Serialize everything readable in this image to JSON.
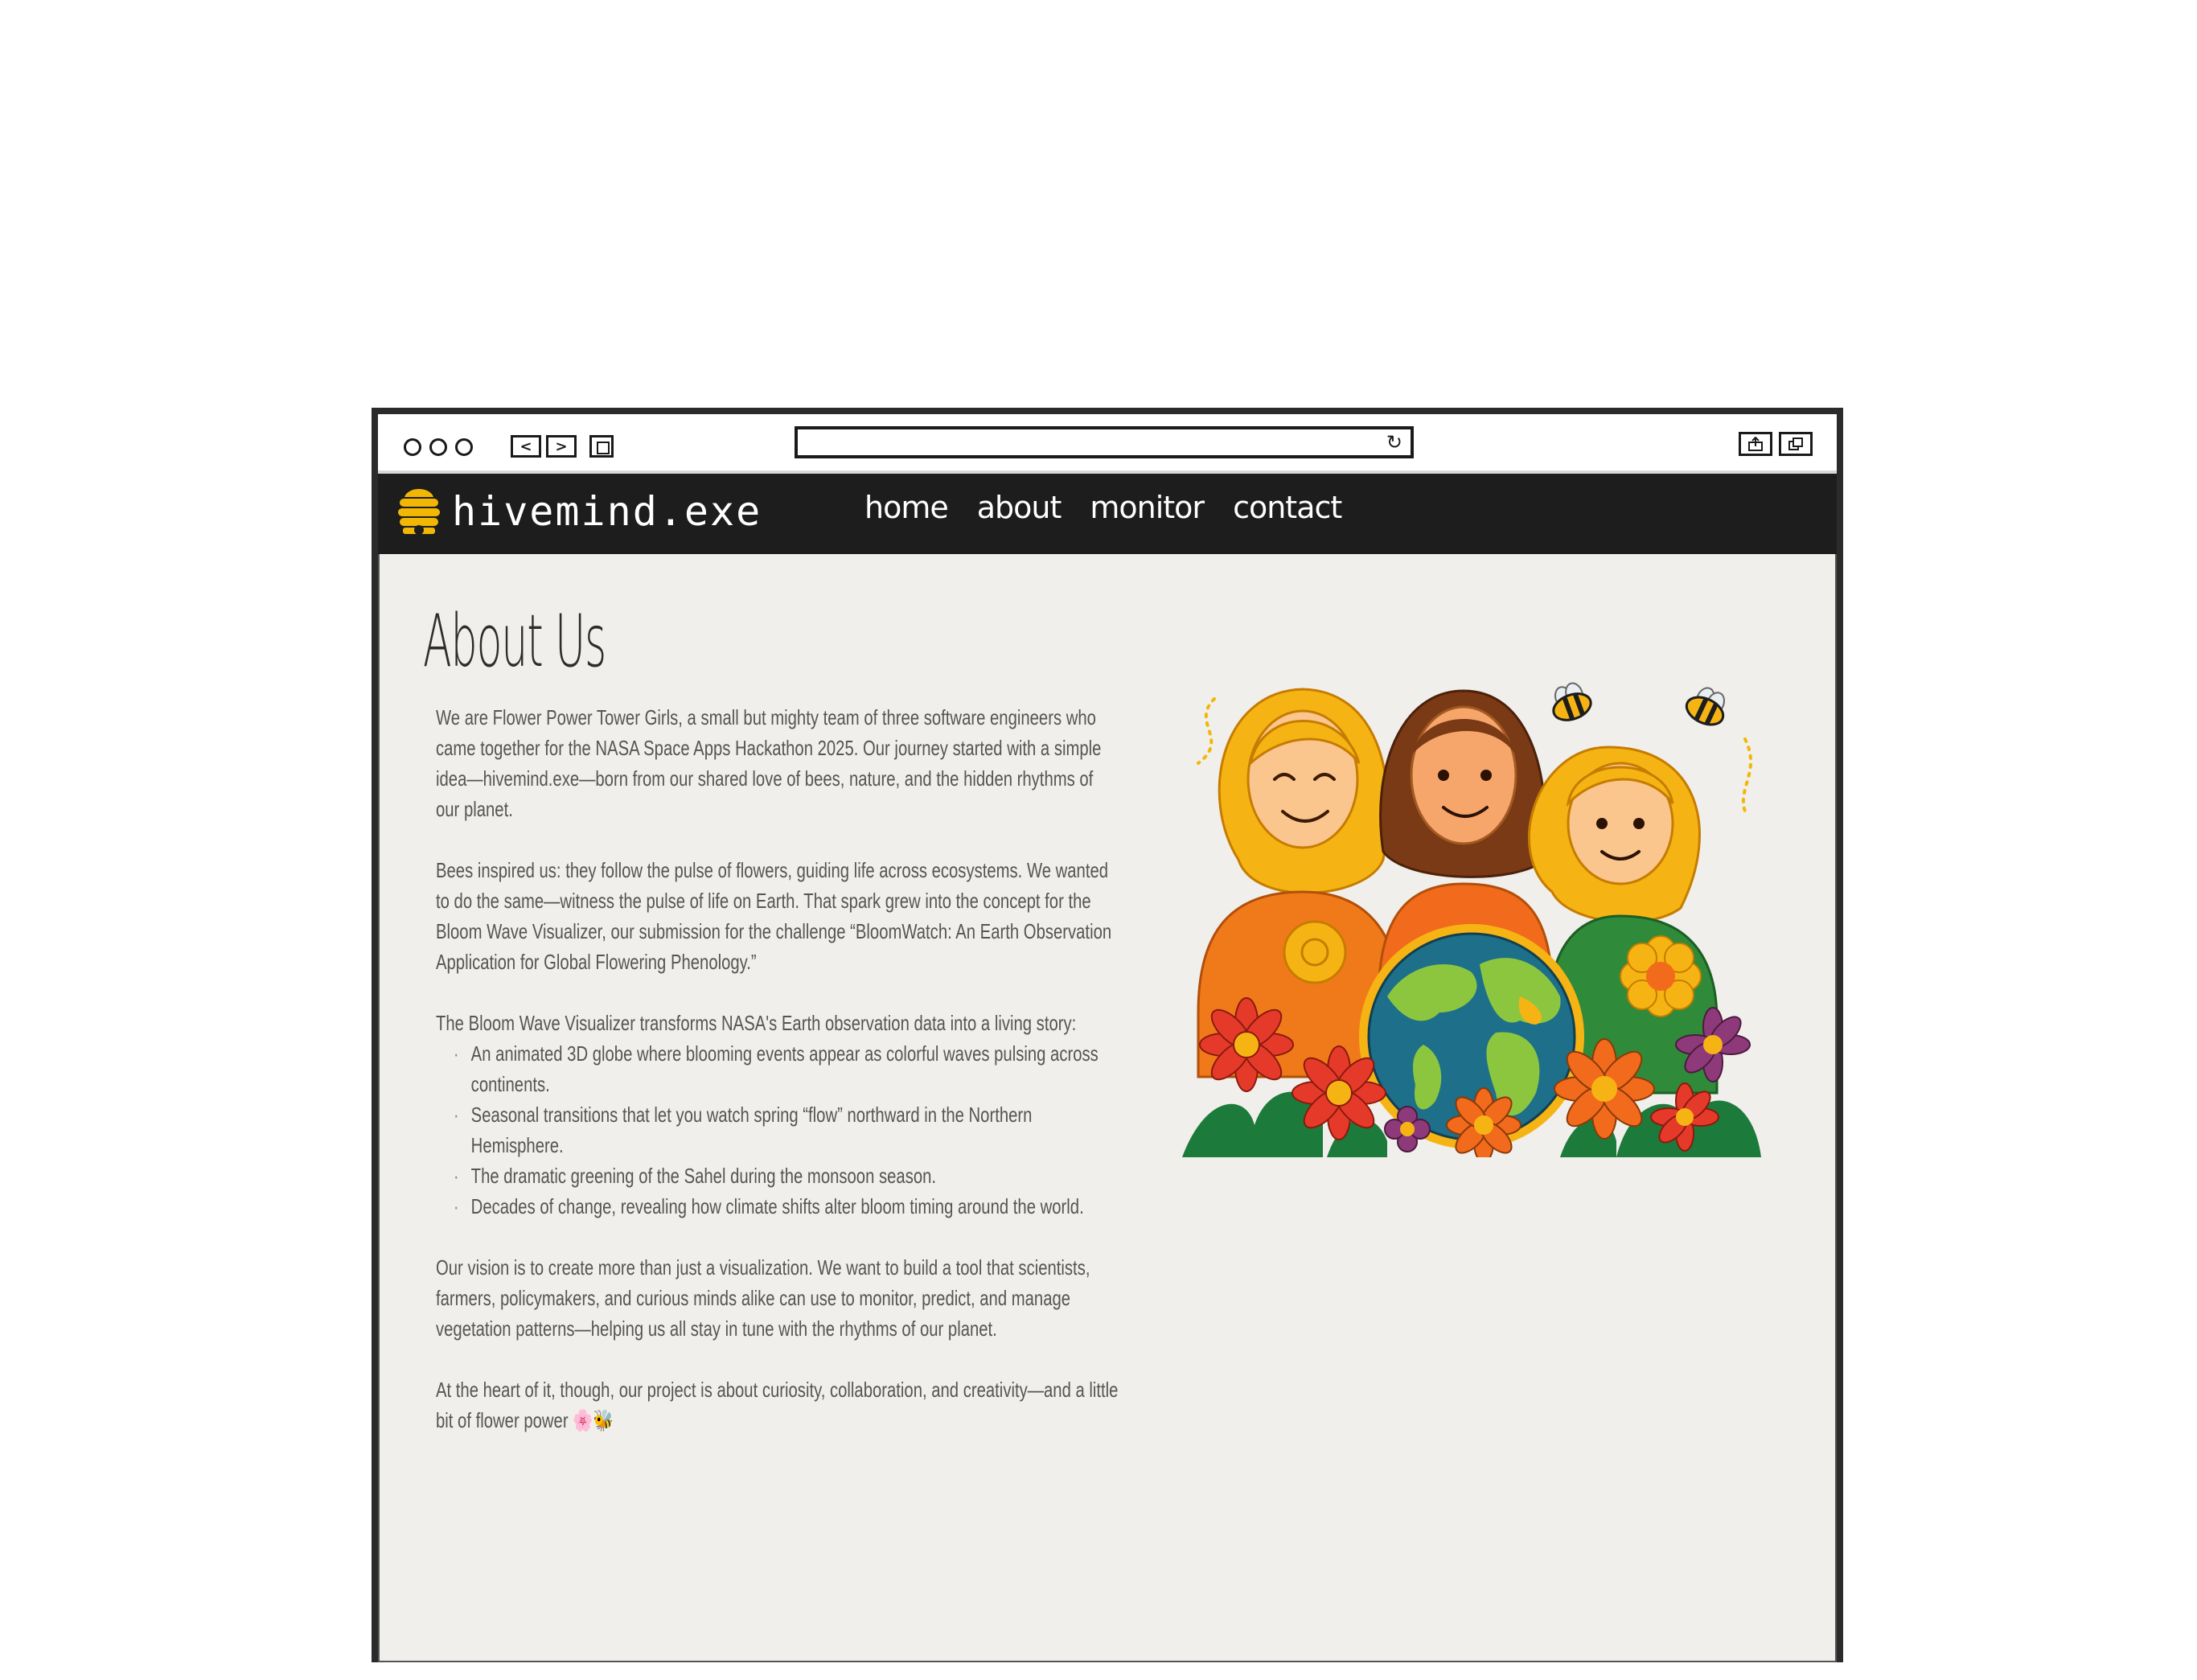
{
  "browser": {
    "back_label": "<",
    "forward_label": ">",
    "reload_icon": "reload-icon",
    "share_icon": "share-icon",
    "tabs_icon": "tabs-icon"
  },
  "site": {
    "logo_text": "hivemind.exe",
    "logo_icon": "beehive-icon",
    "nav": [
      "home",
      "about",
      "monitor",
      "contact"
    ]
  },
  "page": {
    "title": "About Us",
    "paragraph_1": "We are Flower Power Tower Girls, a small but mighty team of three software engineers who came together for the NASA Space Apps Hackathon 2025. Our journey started with a simple idea—hivemind.exe—born from our shared love of bees, nature, and the hidden rhythms of our planet.",
    "paragraph_2": "Bees inspired us: they follow the pulse of flowers, guiding life across ecosystems. We wanted to do the same—witness the pulse of life on Earth. That spark grew into the concept for the Bloom Wave Visualizer, our submission for the challenge “BloomWatch: An Earth Observation Application for Global Flowering Phenology.”",
    "paragraph_3": "The Bloom Wave Visualizer transforms NASA's Earth observation data into a living story:",
    "bullets": [
      "An animated 3D globe where blooming events appear as colorful waves pulsing across continents.",
      "Seasonal transitions that let you watch spring “flow” northward in the Northern Hemisphere.",
      "The dramatic greening of the Sahel during the monsoon season.",
      "Decades of change, revealing how climate shifts alter bloom timing around the world."
    ],
    "paragraph_4": "Our vision is to create more than just a visualization. We want to build a tool that scientists, farmers, policymakers, and curious minds alike can use to monitor, predict, and manage vegetation patterns—helping us all stay in tune with the rhythms of our planet.",
    "paragraph_5": "At the heart of it, though, our project is about curiosity, collaboration, and creativity—and a little bit of flower power 🌸🐝"
  },
  "colors": {
    "nav_bg": "#1c1d1c",
    "content_bg": "#f0efeb",
    "text": "#555555",
    "honey": "#f2b705"
  }
}
